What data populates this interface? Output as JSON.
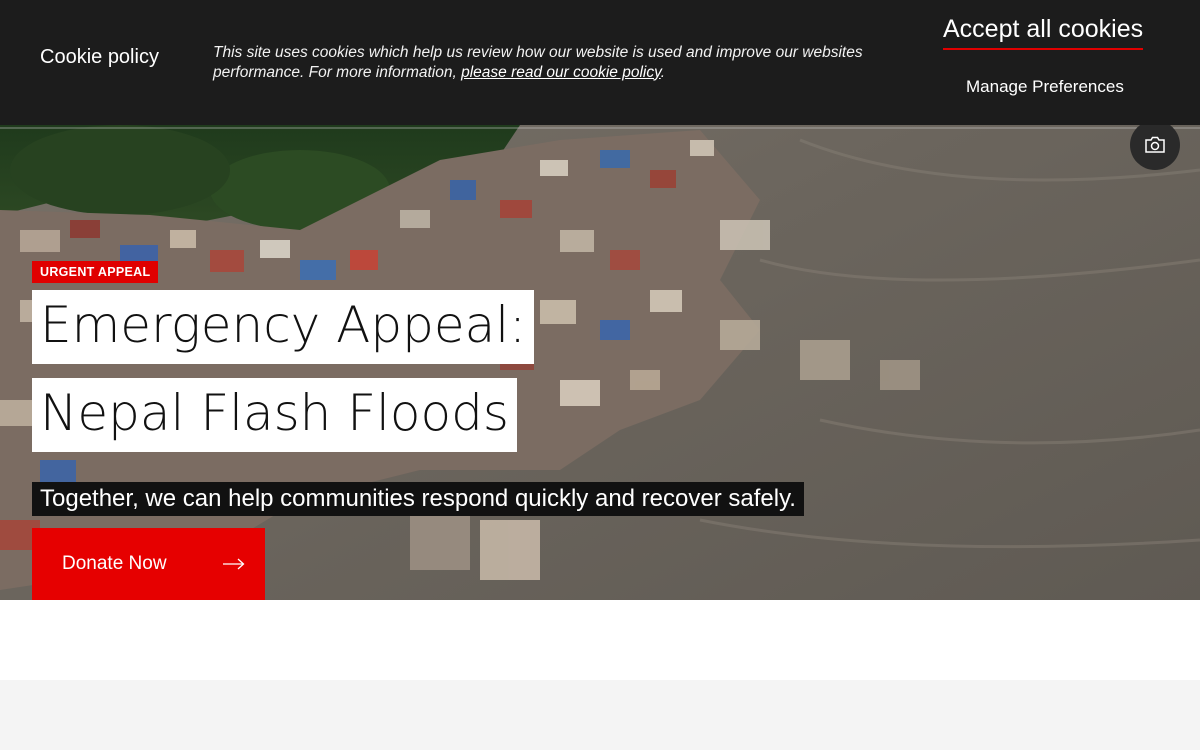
{
  "cookie_banner": {
    "title": "Cookie policy",
    "message": "This site uses cookies which help us review how our website is used and improve our websites performance. For more information, ",
    "link_text": "please read our cookie policy",
    "message_end": ".",
    "accept_label": "Accept all cookies",
    "manage_label": "Manage Preferences"
  },
  "hero": {
    "badge": "URGENT APPEAL",
    "title_line1": "Emergency Appeal:",
    "title_line2": "Nepal Flash Floods",
    "subtitle": "Together, we can help communities respond quickly and recover safely.",
    "cta_label": "Donate Now",
    "camera_icon": "camera-icon",
    "arrow_icon": "arrow-right-icon"
  },
  "colors": {
    "accent_red": "#e60000",
    "banner_bg": "#1c1c1c",
    "lower_band": "#f4f4f4"
  }
}
